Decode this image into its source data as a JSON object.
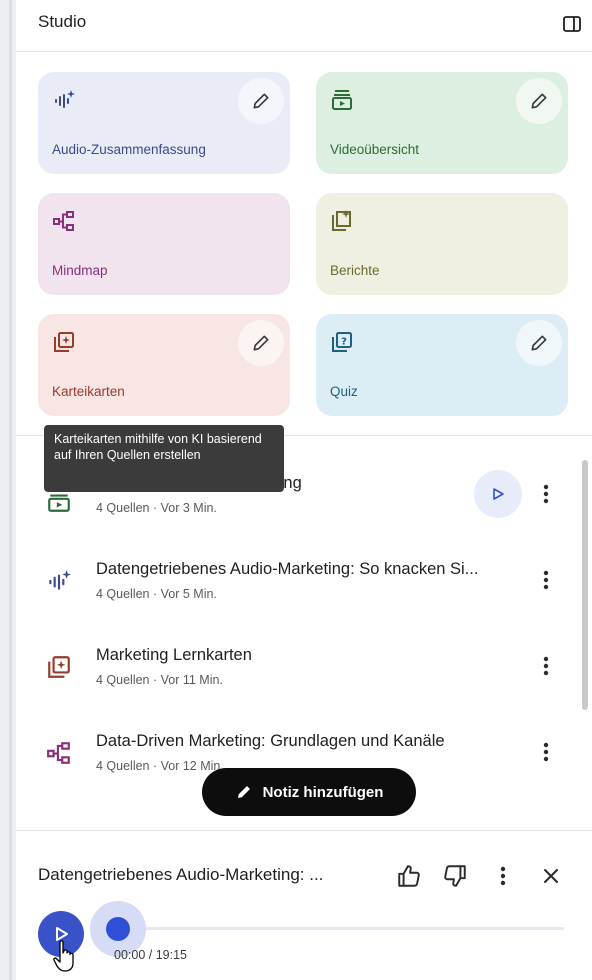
{
  "header": {
    "title": "Studio",
    "toggle_icon": "panel-toggle-icon"
  },
  "cards": [
    {
      "label": "Audio-Zusammenfassung",
      "icon": "audio-sparkle-icon",
      "color": "#3c4a8a",
      "editable": true
    },
    {
      "label": "Videoübersicht",
      "icon": "video-overview-icon",
      "color": "#2e6b3a",
      "editable": true
    },
    {
      "label": "Mindmap",
      "icon": "mindmap-icon",
      "color": "#8a2f7a",
      "editable": false
    },
    {
      "label": "Berichte",
      "icon": "report-icon",
      "color": "#6b6a2e",
      "editable": false
    },
    {
      "label": "Karteikarten",
      "icon": "flashcards-icon",
      "color": "#9a3a2a",
      "editable": true
    },
    {
      "label": "Quiz",
      "icon": "quiz-icon",
      "color": "#1f5f86",
      "editable": true
    }
  ],
  "tooltip": {
    "text": "Karteikarten mithilfe von KI basierend auf Ihren Quellen erstellen"
  },
  "items": [
    {
      "title": "Videoübersicht: Data-Driven Marketing",
      "visible_title_tail": "eting",
      "meta": "4 Quellen · Vor 3 Min.",
      "icon": "video-overview-icon"
    },
    {
      "title": "Datengetriebenes Audio-Marketing: So knacken Si...",
      "meta": "4 Quellen · Vor 5 Min.",
      "icon": "audio-sparkle-icon"
    },
    {
      "title": "Marketing Lernkarten",
      "meta": "4 Quellen · Vor 11 Min.",
      "icon": "flashcards-icon"
    },
    {
      "title": "Data-Driven Marketing: Grundlagen und Kanäle",
      "meta": "4 Quellen · Vor 12 Min.",
      "icon": "mindmap-icon"
    }
  ],
  "add_note": {
    "label": "Notiz hinzufügen"
  },
  "player": {
    "title": "Datengetriebenes Audio-Marketing: ...",
    "time": "00:00 / 19:15",
    "progress": 0
  }
}
